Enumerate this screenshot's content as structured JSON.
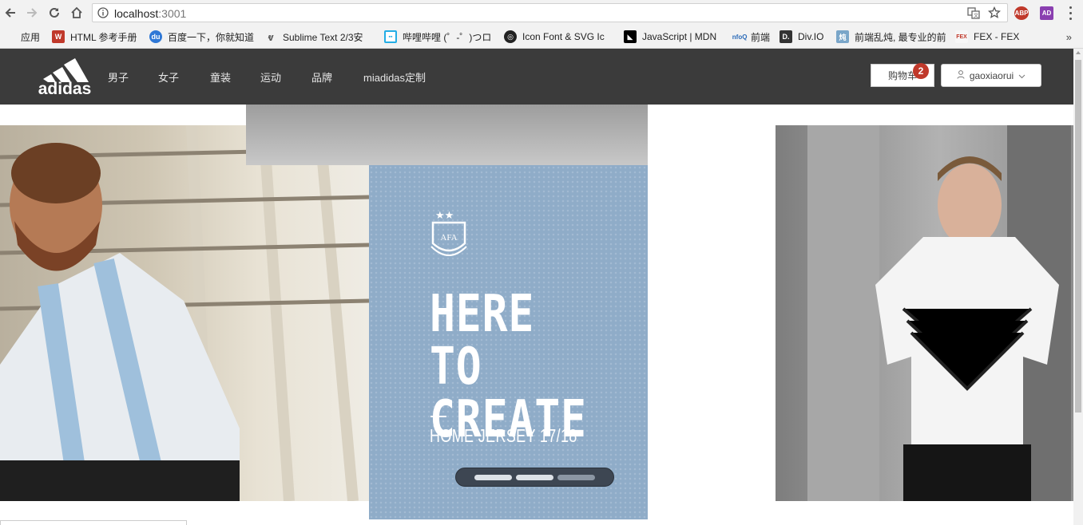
{
  "browser": {
    "url_host": "localhost",
    "url_port": ":3001",
    "icons": {
      "back": "back-arrow-icon",
      "forward": "forward-arrow-icon",
      "reload": "reload-icon",
      "home": "home-icon",
      "info": "info-icon",
      "translate": "translate-icon",
      "star": "star-icon"
    },
    "extensions": [
      {
        "label": "ABP",
        "color": "#c0392b"
      },
      {
        "label": "AD",
        "color": "#8a3fb0"
      }
    ]
  },
  "bookmarks": [
    {
      "label": "应用",
      "icon": "apps-grid-icon"
    },
    {
      "label": "HTML 参考手册",
      "icon": "w3school-icon"
    },
    {
      "label": "百度一下，你就知道",
      "icon": "baidu-paw-icon"
    },
    {
      "label": "Sublime Text 2/3安",
      "icon": "sublime-icon"
    },
    {
      "label": "哔哩哔哩 (゜-゜)つロ",
      "icon": "bilibili-icon"
    },
    {
      "label": "Icon Font & SVG Ic",
      "icon": "iconfont-icon"
    },
    {
      "label": "JavaScript | MDN",
      "icon": "mdn-icon"
    },
    {
      "label": "前端",
      "icon": "info-q-icon"
    },
    {
      "label": "Div.IO",
      "icon": "divio-icon"
    },
    {
      "label": "前端乱炖, 最专业的前",
      "icon": "luandun-icon"
    },
    {
      "label": "FEX - FEX",
      "icon": "fex-icon"
    }
  ],
  "bookmarks_more": "»",
  "site": {
    "brand": "adidas",
    "nav": [
      "男子",
      "女子",
      "童装",
      "运动",
      "品牌",
      "miadidas定制"
    ],
    "cart_label": "购物车",
    "cart_count": "2",
    "username": "gaoxiaorui",
    "colors": {
      "header_bg": "#3b3b3b",
      "badge": "#c0392b",
      "jersey": "#8facc8"
    }
  },
  "carousel": {
    "headline": "HERE TO\nCREATE",
    "subline": "HOME JERSEY 17/18",
    "crest_text": "AFA",
    "dots_total": 3,
    "dots_active": 2
  }
}
